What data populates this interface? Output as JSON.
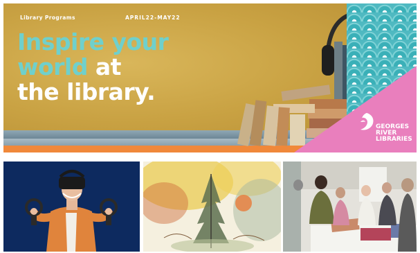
{
  "banner": {
    "program_label": "Library Programs",
    "date_range": "APRIL22-MAY22",
    "headline": {
      "line1": "Inspire your",
      "line2_teal": "world",
      "line2_white": " at",
      "line3": "the library."
    },
    "logo": {
      "line1": "GEORGES",
      "line2": "RIVER",
      "line3": "LIBRARIES"
    },
    "colors": {
      "teal": "#6fd0cc",
      "orange": "#f0883a",
      "pink": "#e97fbd",
      "mustard": "#c9a243"
    }
  },
  "photos": {
    "vr": {
      "icon": "vr-headset-person"
    },
    "art": {
      "icon": "watercolor-tree"
    },
    "craft": {
      "icon": "craft-workshop-people"
    }
  }
}
